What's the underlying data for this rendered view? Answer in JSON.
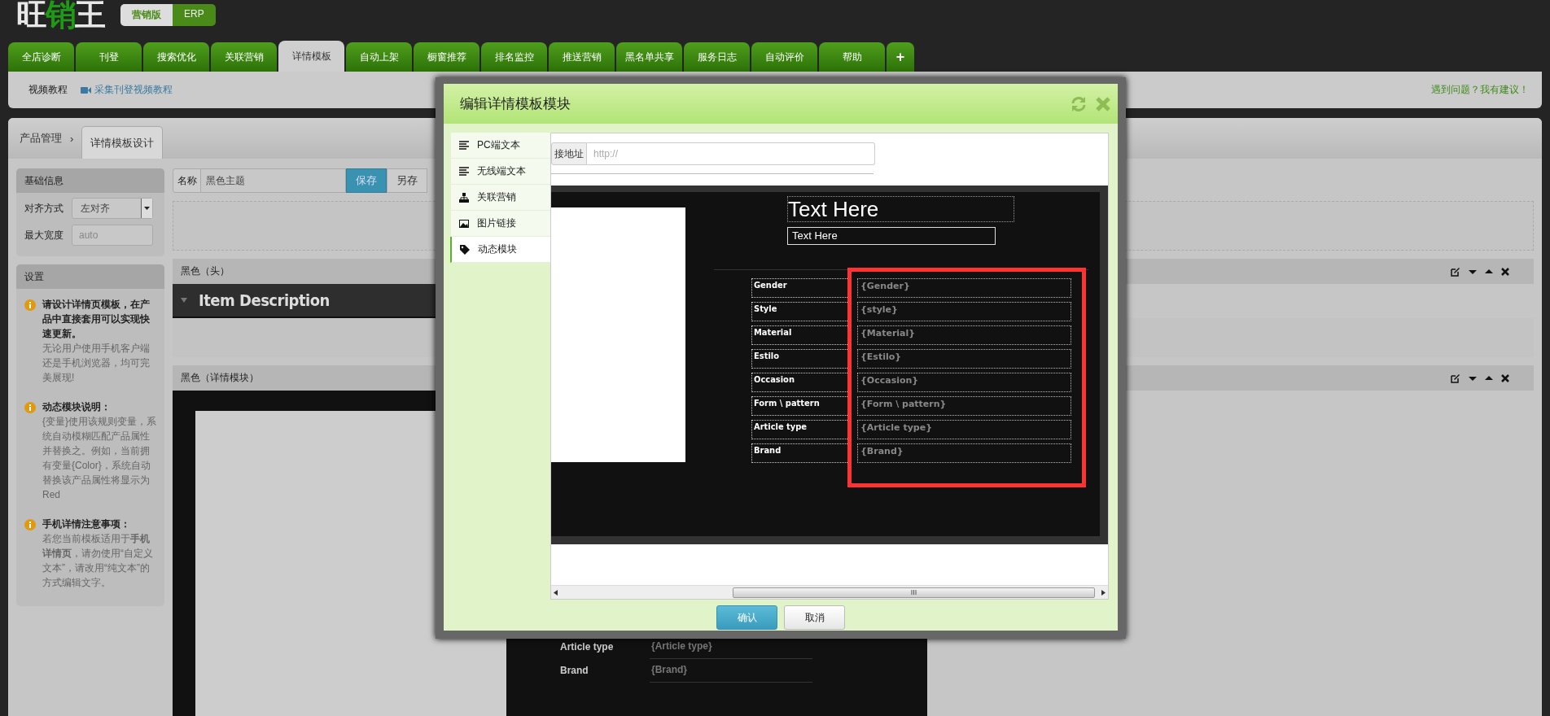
{
  "logo": [
    {
      "text": "旺",
      "color": "#e8e8e8"
    },
    {
      "text": "销",
      "color": "#1f9a14"
    },
    {
      "text": "王",
      "color": "#e8e8e8"
    }
  ],
  "edition_toggle": [
    {
      "label": "营销版",
      "selected": true
    },
    {
      "label": "ERP",
      "selected": false
    }
  ],
  "nav_tabs": [
    {
      "label": "全店诊断",
      "selected": false
    },
    {
      "label": "刊登",
      "selected": false
    },
    {
      "label": "搜索优化",
      "selected": false
    },
    {
      "label": "关联营销",
      "selected": false
    },
    {
      "label": "详情模板",
      "selected": true
    },
    {
      "label": "自动上架",
      "selected": false
    },
    {
      "label": "橱窗推荐",
      "selected": false
    },
    {
      "label": "排名监控",
      "selected": false
    },
    {
      "label": "推送营销",
      "selected": false
    },
    {
      "label": "黑名单共享",
      "selected": false
    },
    {
      "label": "服务日志",
      "selected": false
    },
    {
      "label": "自动评价",
      "selected": false
    },
    {
      "label": "帮助",
      "selected": false
    },
    {
      "label": "+",
      "selected": false
    }
  ],
  "subbar": {
    "label": "视频教程",
    "video_link": "采集刊登视频教程",
    "feedback_link": "遇到问题？我有建议！"
  },
  "breadcrumb": {
    "root": "产品管理",
    "separator": "›",
    "tabs": [
      {
        "label": "详情模板设计",
        "selected": true
      }
    ]
  },
  "basic_info": {
    "title": "基础信息",
    "fields": [
      {
        "label": "对齐方式",
        "kind": "select",
        "value": "左对齐"
      },
      {
        "label": "最大宽度",
        "kind": "input",
        "placeholder": "auto"
      }
    ]
  },
  "settings": {
    "title": "设置",
    "notes": [
      {
        "heading": "请设计详情页模板，在产品中直接套用可以实现快速更新。",
        "body": "无论用户使用手机客户端还是手机浏览器，均可完美展现!"
      },
      {
        "heading": "动态模块说明：",
        "body": "{变量}使用该规则变量，系统自动模糊匹配产品属性并替换之。例如，当前拥有变量{Color}，系统自动替换该产品属性将显示为Red"
      },
      {
        "heading": "手机详情注意事项：",
        "body": "若您当前模板适用于**手机详情页**，请勿使用“自定义文本”，请改用“纯文本”的方式编辑文字。"
      }
    ]
  },
  "name_bar": {
    "label": "名称",
    "value": "黑色主题",
    "buttons": [
      {
        "label": "保存",
        "kind": "primary"
      },
      {
        "label": "另存",
        "kind": "default"
      }
    ]
  },
  "sections": [
    {
      "title": "黑色（头）",
      "kind": "header",
      "heading": "Item Description"
    },
    {
      "title": "黑色（详情模块）",
      "kind": "detail",
      "rows": [
        {
          "label": "Article type",
          "value": "{Article type}"
        },
        {
          "label": "Brand",
          "value": "{Brand}"
        }
      ]
    }
  ],
  "modal": {
    "title": "编辑详情模板模块",
    "menu": [
      {
        "label": "PC端文本",
        "selected": false
      },
      {
        "label": "无线端文本",
        "selected": false
      },
      {
        "label": "关联营销",
        "selected": false
      },
      {
        "label": "图片链接",
        "selected": false
      },
      {
        "label": "动态模块",
        "selected": true
      }
    ],
    "url_field": {
      "label": "接地址",
      "placeholder": "http://"
    },
    "preview": {
      "title": "Text Here",
      "subtitle": "Text Here",
      "values_highlighted": true,
      "attributes": [
        {
          "label": "Gender",
          "value": "{Gender}"
        },
        {
          "label": "Style",
          "value": "{style}"
        },
        {
          "label": "Material",
          "value": "{Material}"
        },
        {
          "label": "Estilo",
          "value": "{Estilo}"
        },
        {
          "label": "Occasion",
          "value": "{Occasion}"
        },
        {
          "label": "Form \\ pattern",
          "value": "{Form \\ pattern}"
        },
        {
          "label": "Article type",
          "value": "{Article type}"
        },
        {
          "label": "Brand",
          "value": "{Brand}"
        }
      ]
    },
    "buttons": [
      {
        "label": "确认",
        "kind": "primary"
      },
      {
        "label": "取消",
        "kind": "default"
      }
    ]
  }
}
